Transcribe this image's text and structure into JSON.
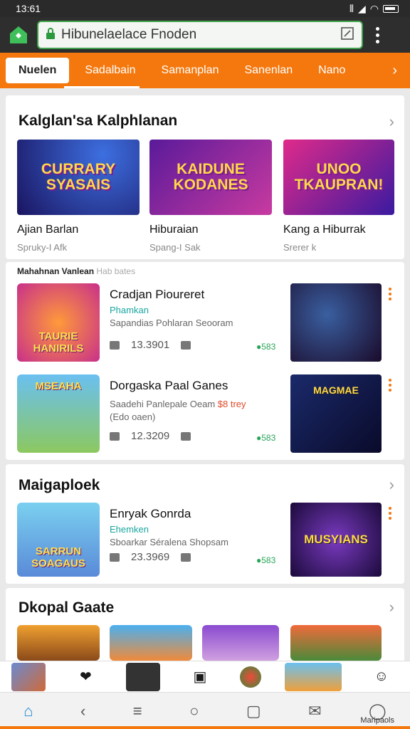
{
  "status": {
    "time": "13:61"
  },
  "browser": {
    "url": "Hibunelaelace Fnoden"
  },
  "tabs": [
    {
      "label": "Nuelen",
      "active": true
    },
    {
      "label": "Sadalbain"
    },
    {
      "label": "Samanplan"
    },
    {
      "label": "Sanenlan"
    },
    {
      "label": "Nano"
    }
  ],
  "featured": {
    "title": "Kalglan'sa Kalphlanan",
    "items": [
      {
        "art": "CURRARY SYASAIS",
        "name": "Ajian Barlan",
        "sub": "Spruky-I Afk"
      },
      {
        "art": "KAIDUNE KODANES",
        "name": "Hiburaian",
        "sub": "Spang-I Sak"
      },
      {
        "art": "UNOO TKAUPRAN!",
        "name": "Kang a Hiburrak",
        "sub": "Srerer k"
      }
    ]
  },
  "list": {
    "head": "Mahahnan Vanlean",
    "head_faint": "Hab bates",
    "rows": [
      {
        "art": "TAURIE HANIRILS",
        "title": "Cradjan Pioureret",
        "cat": "Phamkan",
        "desc": "Sapandias Pohlaran Seooram",
        "count": "13.3901",
        "rate": "●583",
        "shot_art": ""
      },
      {
        "art": "MSEAHA",
        "title": "Dorgaska Paal Ganes",
        "cat": "",
        "desc": "Saadehi Panlepale Oeam",
        "desc_price": "$8 trey",
        "desc2": "(Edo oaen)",
        "count": "12.3209",
        "rate": "●583",
        "shot_art": "MAGMAE"
      }
    ]
  },
  "section3": {
    "title": "Maigaploek",
    "row": {
      "art": "SARRUN SOAGAUS",
      "title": "Enryak Gonrda",
      "cat": "Ehemken",
      "desc": "Sboarkar Séralena Shopsam",
      "count": "23.3969",
      "rate": "●583",
      "shot_art": "MUSYIANS"
    }
  },
  "section4": {
    "title": "Dkopal Gaate"
  },
  "navbar": {
    "label": "Maripaols"
  },
  "colors": {
    "accent": "#f4780e",
    "green": "#3fa14a"
  }
}
